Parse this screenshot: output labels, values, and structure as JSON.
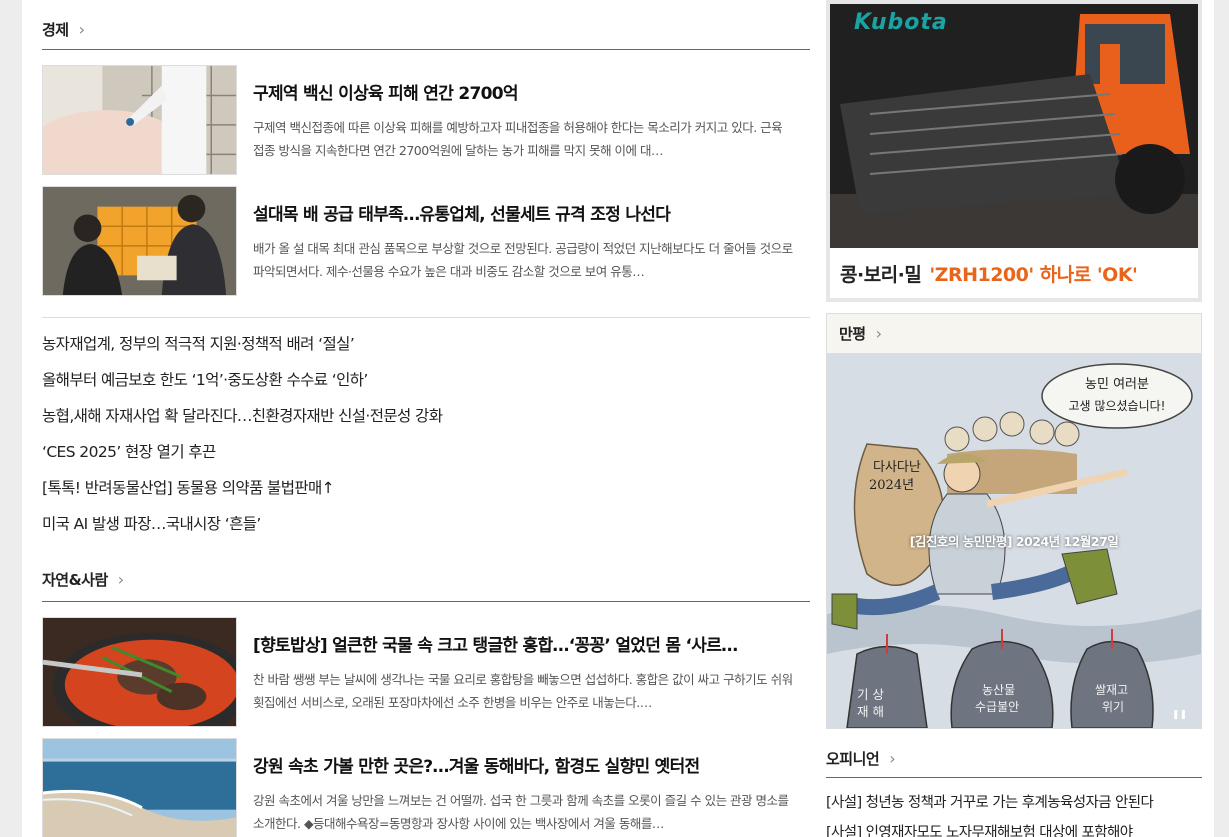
{
  "economy": {
    "title": "경제",
    "articles": [
      {
        "title": "구제역 백신 이상육 피해 연간 2700억",
        "summary": "구제역 백신접종에 따른 이상육 피해를 예방하고자 피내접종을 허용해야 한다는 목소리가 커지고 있다. 근육접종 방식을 지속한다면 연간 2700억원에 달하는 농가 피해를 막지 못해 이에 대…"
      },
      {
        "title": "설대목 배 공급 태부족…유통업체, 선물세트 규격 조정 나선다",
        "summary": "배가 올 설 대목 최대 관심 품목으로 부상할 것으로 전망된다. 공급량이 적었던 지난해보다도 더 줄어들 것으로 파악되면서다. 제수·선물용 수요가 높은 대과 비중도 감소할 것으로 보여 유통…"
      }
    ],
    "headlines": [
      "농자재업계, 정부의 적극적 지원·정책적 배려 ‘절실’",
      "올해부터 예금보호 한도 ‘1억’·중도상환 수수료 ‘인하’",
      "농협,새해 자재사업 확 달라진다…친환경자재반 신설·전문성 강화",
      "‘CES 2025’ 현장 열기 후끈",
      "[톡톡! 반려동물산업] 동물용 의약품 불법판매↑",
      "미국 AI 발생 파장…국내시장 ‘흔들’"
    ]
  },
  "nature": {
    "title": "자연&사람",
    "articles": [
      {
        "title": "[향토밥상] 얼큰한 국물 속 크고 탱글한 홍합…‘꽁꽁’ 얼었던 몸 ‘사르…",
        "summary": "찬 바람 쌩쌩 부는 날씨에 생각나는 국물 요리로 홍합탕을 빼놓으면 섭섭하다. 홍합은 값이 싸고 구하기도 쉬워 횟집에선 서비스로, 오래된 포장마차에선 소주 한병을 비우는 안주로 내놓는다.…"
      },
      {
        "title": "강원 속초 가볼 만한 곳은?…겨울 동해바다, 함경도 실향민 옛터전",
        "summary": "강원 속초에서 겨울 낭만을 느껴보는 건 어떨까. 섭국 한 그릇과 함께 속초를 오롯이 즐길 수 있는 관광 명소를 소개한다. ◆등대해수욕장=동명항과 장사항 사이에 있는 백사장에서 겨울 동해를…"
      }
    ]
  },
  "ad": {
    "brand": "Kubota",
    "caption_main": "콩·보리·밀",
    "caption_highlight": "'ZRH1200' 하나로 'OK'"
  },
  "cartoon": {
    "title": "만평",
    "caption": "[김진호의 농민만평] 2024년 12월27일",
    "bubble_line1": "농민 여러분",
    "bubble_line2": "고생 많으셨습니다!",
    "year_line1": "다사다난",
    "year_line2": "2024년",
    "bomb1": "기 상\n재 해",
    "bomb2": "농산물\n수급불안",
    "bomb3": "쌀재고\n위기"
  },
  "opinion": {
    "title": "오피니언",
    "items": [
      "[사설] 청년농 정책과 거꾸로 가는 후계농육성자금 안된다",
      "[사설] 인영재자모도 노자무재해보험 대상에 포함해야"
    ]
  },
  "colors": {
    "accent": "#2b7d8f",
    "ad_highlight": "#e8651a"
  },
  "icons": {
    "section_more": "chevron-right-icon"
  }
}
